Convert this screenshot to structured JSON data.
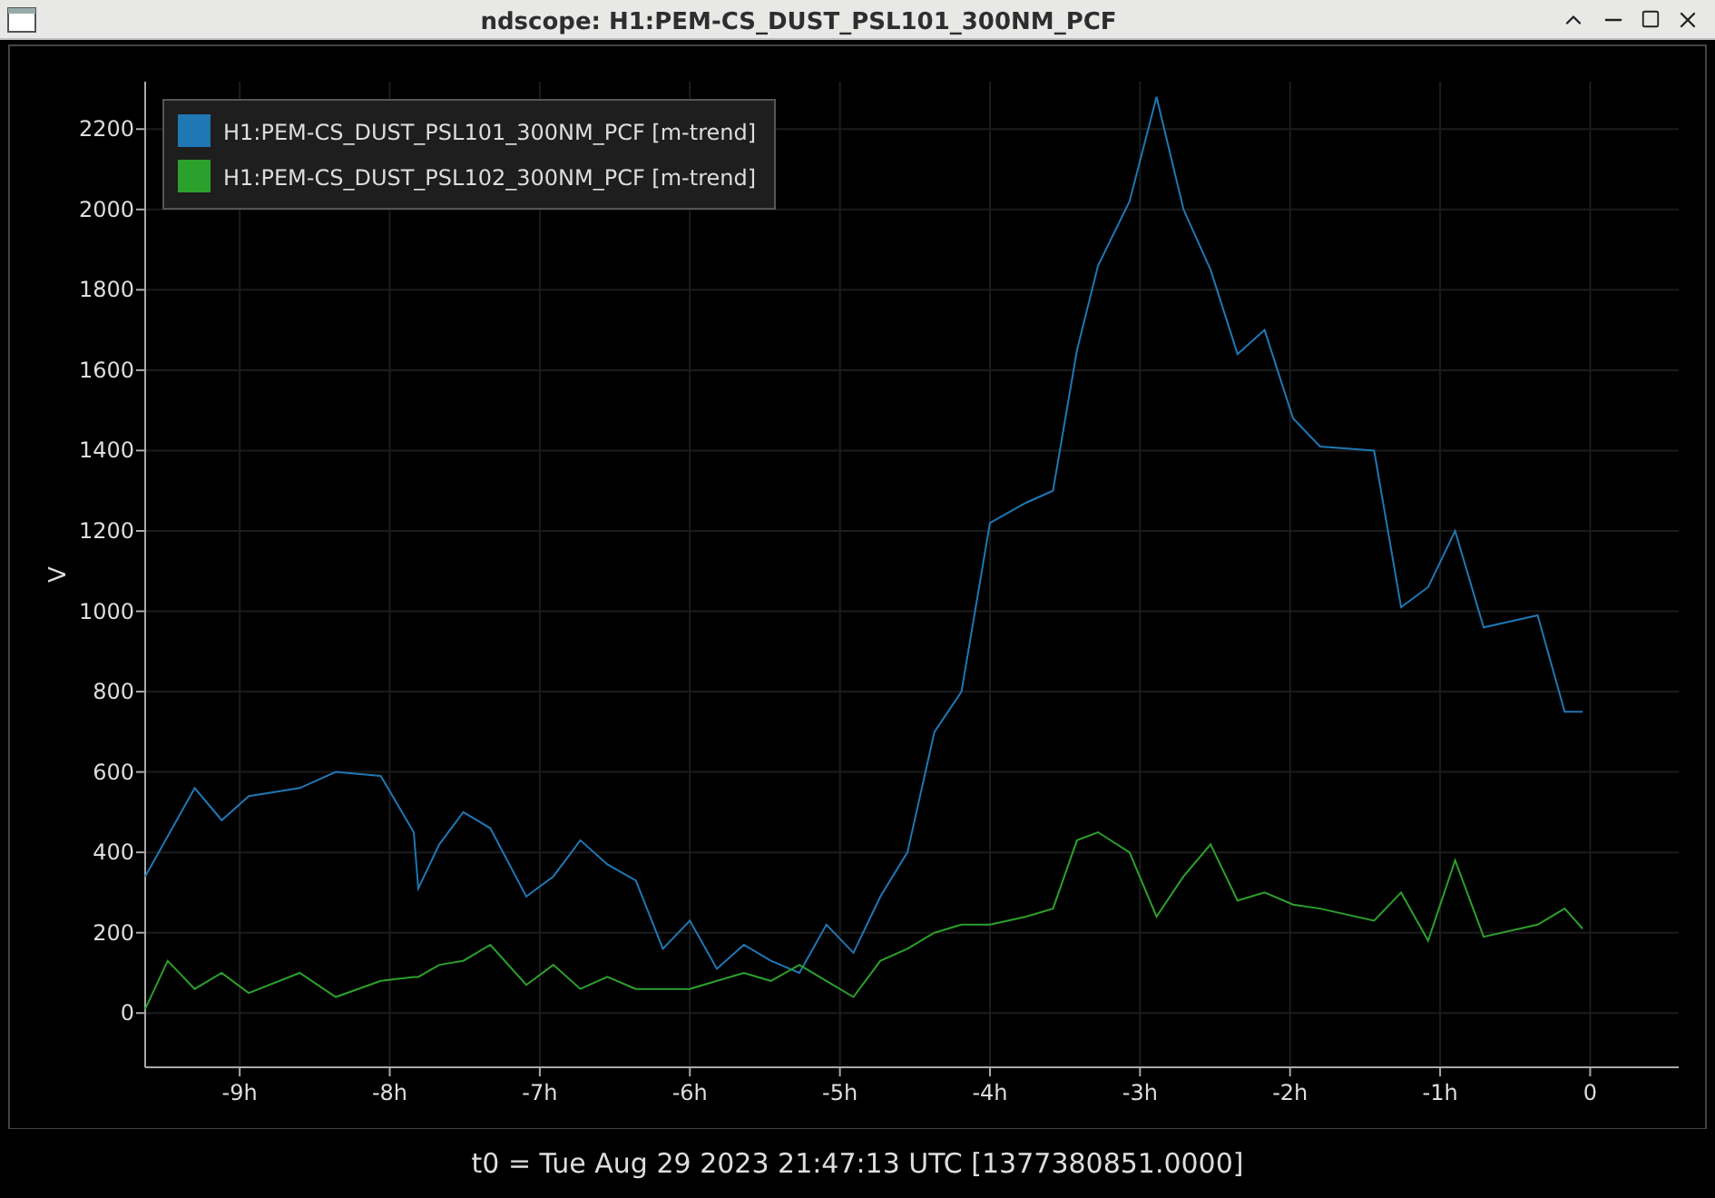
{
  "window": {
    "title": "ndscope: H1:PEM-CS_DUST_PSL101_300NM_PCF"
  },
  "plot": {
    "chart_data": {
      "type": "line",
      "ylabel": "V",
      "grid": true,
      "legend": true,
      "xlim": [
        -9.63,
        0.59
      ],
      "ylim": [
        -135,
        2318
      ],
      "xticks": [
        {
          "value": -9,
          "label": "-9h"
        },
        {
          "value": -8,
          "label": "-8h"
        },
        {
          "value": -7,
          "label": "-7h"
        },
        {
          "value": -6,
          "label": "-6h"
        },
        {
          "value": -5,
          "label": "-5h"
        },
        {
          "value": -4,
          "label": "-4h"
        },
        {
          "value": -3,
          "label": "-3h"
        },
        {
          "value": -2,
          "label": "-2h"
        },
        {
          "value": -1,
          "label": "-1h"
        },
        {
          "value": 0,
          "label": "0"
        }
      ],
      "yticks": [
        0,
        200,
        400,
        600,
        800,
        1000,
        1200,
        1400,
        1600,
        1800,
        2000,
        2200
      ],
      "x": [
        -9.63,
        -9.48,
        -9.3,
        -9.12,
        -8.94,
        -8.6,
        -8.36,
        -8.06,
        -7.84,
        -7.81,
        -7.67,
        -7.51,
        -7.33,
        -7.09,
        -6.91,
        -6.73,
        -6.55,
        -6.36,
        -6.18,
        -6.0,
        -5.82,
        -5.64,
        -5.46,
        -5.27,
        -5.09,
        -4.91,
        -4.73,
        -4.55,
        -4.37,
        -4.19,
        -4.0,
        -3.76,
        -3.58,
        -3.42,
        -3.28,
        -3.07,
        -2.89,
        -2.71,
        -2.53,
        -2.35,
        -2.17,
        -1.98,
        -1.8,
        -1.44,
        -1.26,
        -1.08,
        -0.9,
        -0.71,
        -0.35,
        -0.17,
        -0.05
      ],
      "series": [
        {
          "name": "H1:PEM-CS_DUST_PSL101_300NM_PCF [m-trend]",
          "color": "#1f77b4",
          "values": [
            340,
            440,
            560,
            480,
            540,
            560,
            600,
            590,
            450,
            310,
            420,
            500,
            460,
            290,
            340,
            430,
            370,
            330,
            160,
            230,
            110,
            170,
            130,
            100,
            220,
            150,
            290,
            400,
            700,
            800,
            1220,
            1270,
            1300,
            1650,
            1860,
            2020,
            2280,
            2000,
            1850,
            1640,
            1700,
            1480,
            1410,
            1400,
            1010,
            1060,
            1200,
            960,
            990,
            750,
            750
          ]
        },
        {
          "name": "H1:PEM-CS_DUST_PSL102_300NM_PCF [m-trend]",
          "color": "#2ca02c",
          "values": [
            10,
            130,
            60,
            100,
            50,
            100,
            40,
            80,
            90,
            90,
            120,
            130,
            170,
            70,
            120,
            60,
            90,
            60,
            60,
            60,
            80,
            100,
            80,
            120,
            80,
            40,
            130,
            160,
            200,
            220,
            220,
            240,
            260,
            430,
            450,
            400,
            240,
            340,
            420,
            280,
            300,
            270,
            260,
            230,
            300,
            180,
            380,
            190,
            220,
            260,
            210
          ]
        }
      ]
    }
  },
  "footer": "t0 = Tue Aug 29 2023 21:47:13 UTC [1377380851.0000]"
}
